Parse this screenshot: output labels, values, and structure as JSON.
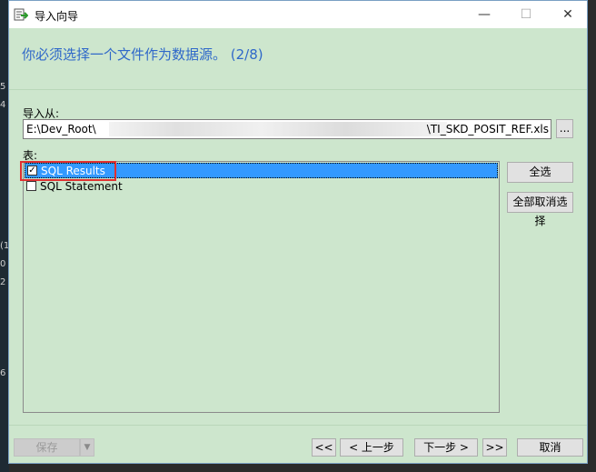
{
  "window": {
    "title": "导入向导",
    "header": "你必须选择一个文件作为数据源。 (2/8)"
  },
  "import_from": {
    "label": "导入从:",
    "path_start": "E:\\Dev_Root\\",
    "path_end": "\\TI_SKD_POSIT_REF.xls",
    "browse_label": "..."
  },
  "tables": {
    "label": "表:",
    "items": [
      {
        "label": "SQL Results",
        "checked": true,
        "selected": true
      },
      {
        "label": "SQL Statement",
        "checked": false,
        "selected": false
      }
    ],
    "select_all": "全选",
    "deselect_all": "全部取消选择"
  },
  "footer": {
    "save": "保存",
    "first": "<<",
    "prev": "< 上一步",
    "next": "下一步 >",
    "last": ">>",
    "cancel": "取消"
  },
  "colors": {
    "dialog_bg": "#cde6cd",
    "header_text": "#2f68c9",
    "selection": "#3399ff",
    "highlight_box": "#e03030"
  }
}
